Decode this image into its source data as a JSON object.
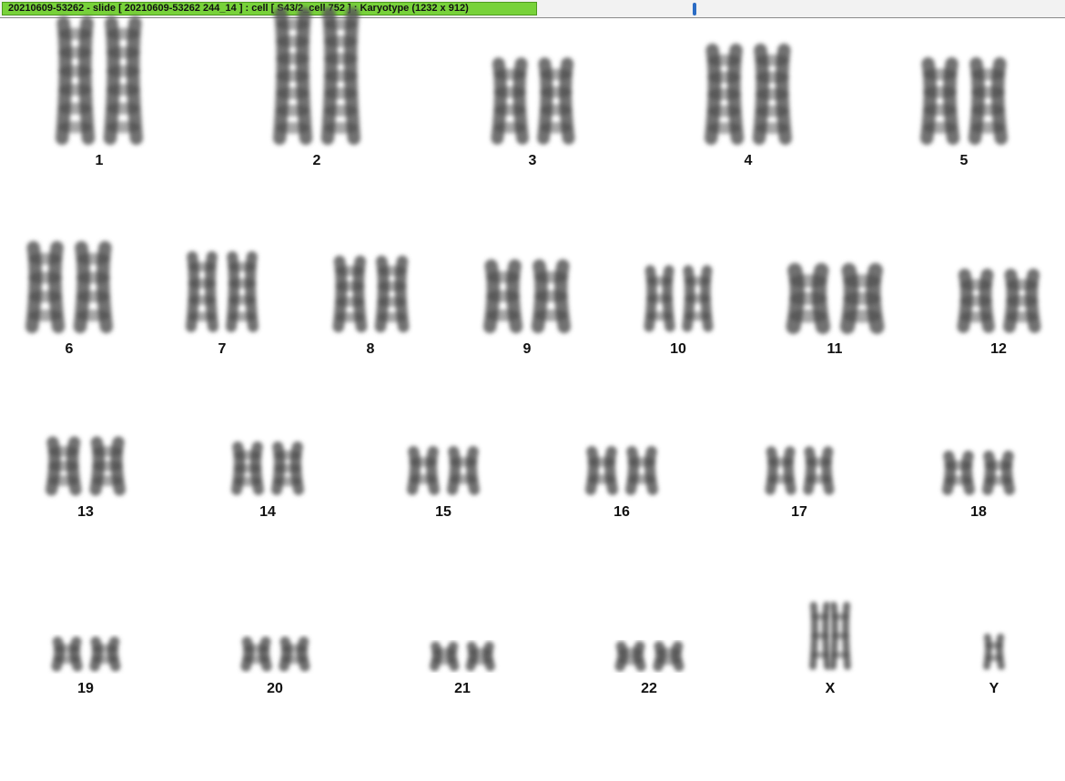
{
  "window": {
    "title": "20210609-53262 - slide [ 20210609-53262 244_14 ] : cell [ S43/2_cell 752 ] : Karyotype  (1232 x 912)"
  },
  "colors": {
    "title_bar": "#78d23a",
    "chromosome": "#585858",
    "background": "#ffffff"
  },
  "karyotype": {
    "chromosomes": [
      {
        "label": "1"
      },
      {
        "label": "2"
      },
      {
        "label": "3"
      },
      {
        "label": "4"
      },
      {
        "label": "5"
      },
      {
        "label": "6"
      },
      {
        "label": "7"
      },
      {
        "label": "8"
      },
      {
        "label": "9"
      },
      {
        "label": "10"
      },
      {
        "label": "11"
      },
      {
        "label": "12"
      },
      {
        "label": "13"
      },
      {
        "label": "14"
      },
      {
        "label": "15"
      },
      {
        "label": "16"
      },
      {
        "label": "17"
      },
      {
        "label": "18"
      },
      {
        "label": "19"
      },
      {
        "label": "20"
      },
      {
        "label": "21"
      },
      {
        "label": "22"
      },
      {
        "label": "X"
      },
      {
        "label": "Y"
      }
    ]
  }
}
